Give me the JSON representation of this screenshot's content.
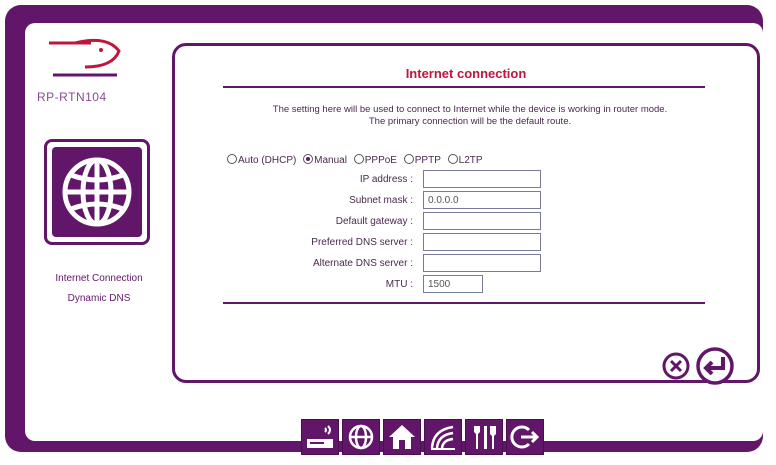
{
  "device": {
    "model": "RP-RTN104"
  },
  "sidebar": {
    "links": [
      {
        "label": "Internet Connection"
      },
      {
        "label": "Dynamic DNS"
      }
    ]
  },
  "panel": {
    "title": "Internet connection",
    "description_line1": "The setting here will be used to connect to Internet while the device is working in router mode.",
    "description_line2": "The primary connection will be the default route.",
    "connection_types": [
      {
        "label": "Auto (DHCP)",
        "selected": false
      },
      {
        "label": "Manual",
        "selected": true
      },
      {
        "label": "PPPoE",
        "selected": false
      },
      {
        "label": "PPTP",
        "selected": false
      },
      {
        "label": "L2TP",
        "selected": false
      }
    ],
    "fields": {
      "ip_address": {
        "label": "IP address :",
        "value": ""
      },
      "subnet_mask": {
        "label": "Subnet mask :",
        "value": "0.0.0.0"
      },
      "default_gateway": {
        "label": "Default gateway :",
        "value": ""
      },
      "preferred_dns": {
        "label": "Preferred DNS server :",
        "value": ""
      },
      "alternate_dns": {
        "label": "Alternate DNS server :",
        "value": ""
      },
      "mtu": {
        "label": "MTU :",
        "value": "1500"
      }
    }
  },
  "colors": {
    "brand": "#62166a",
    "title": "#c0153d"
  },
  "icons": {
    "actions": [
      "cancel-icon",
      "apply-icon"
    ],
    "nav": [
      "device-icon",
      "internet-icon",
      "home-icon",
      "wireless-icon",
      "tools-icon",
      "logout-icon"
    ]
  }
}
